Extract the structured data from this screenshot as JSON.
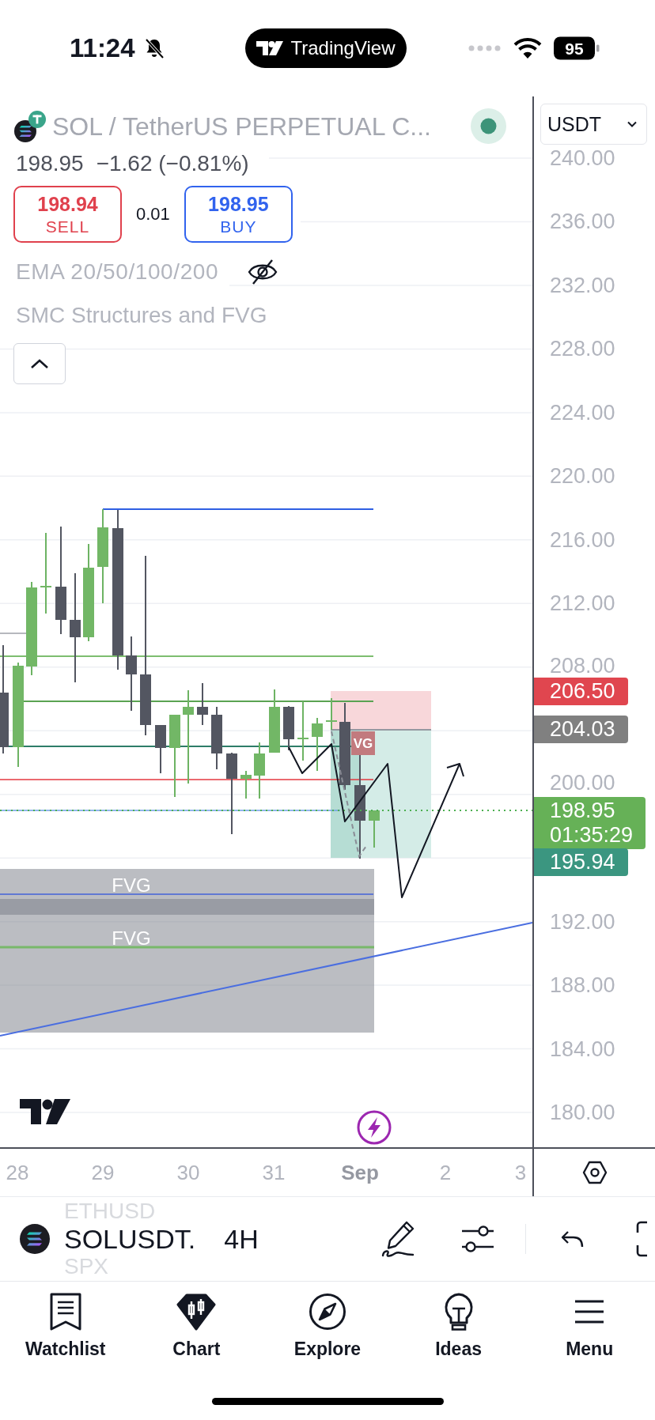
{
  "status_bar": {
    "time": "11:24",
    "silenced": true,
    "app_badge": "TradingView",
    "battery": "95"
  },
  "symbol": {
    "title": "SOL / TetherUS PERPETUAL C...",
    "live": true,
    "currency": "USDT",
    "price": "198.95",
    "change": "−1.62 (−0.81%)"
  },
  "trade": {
    "sell": {
      "price": "198.94",
      "label": "SELL"
    },
    "spread": "0.01",
    "buy": {
      "price": "198.95",
      "label": "BUY"
    }
  },
  "indicators": [
    {
      "name": "EMA 20/50/100/200",
      "hidden": true
    },
    {
      "name": "SMC Structures and FVG",
      "hidden": false
    }
  ],
  "chart": {
    "fvg_zones": [
      {
        "label": "FVG"
      },
      {
        "label": "FVG"
      }
    ],
    "position_label": "VG"
  },
  "price_axis": {
    "labels": [
      "240.00",
      "236.00",
      "232.00",
      "228.00",
      "224.00",
      "220.00",
      "216.00",
      "212.00",
      "208.00",
      "200.00",
      "192.00",
      "188.00",
      "184.00",
      "180.00"
    ],
    "tags": [
      {
        "text": "206.50",
        "color": "#e0464f"
      },
      {
        "text": "204.03",
        "color": "#808080"
      },
      {
        "text": "198.95",
        "countdown": "01:35:29",
        "color": "#66b157"
      },
      {
        "text": "195.94",
        "color": "#3b9680"
      }
    ]
  },
  "time_axis": [
    {
      "label": "28",
      "kind": "day"
    },
    {
      "label": "29",
      "kind": "day"
    },
    {
      "label": "30",
      "kind": "day"
    },
    {
      "label": "31",
      "kind": "day"
    },
    {
      "label": "Sep",
      "kind": "month"
    },
    {
      "label": "2",
      "kind": "day"
    },
    {
      "label": "3",
      "kind": "day"
    }
  ],
  "toolbar": {
    "picker_above": "ETHUSD",
    "symbol": "SOLUSDT.",
    "picker_below": "SPX",
    "interval": "4H"
  },
  "tabs": [
    {
      "label": "Watchlist",
      "selected": false
    },
    {
      "label": "Chart",
      "selected": true
    },
    {
      "label": "Explore",
      "selected": false
    },
    {
      "label": "Ideas",
      "selected": false
    },
    {
      "label": "Menu",
      "selected": false
    }
  ]
}
